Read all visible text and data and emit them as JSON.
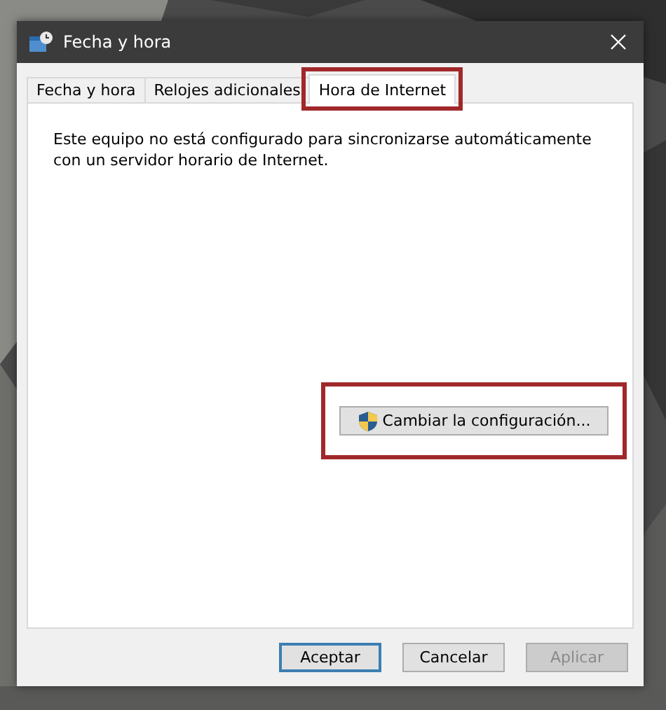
{
  "window": {
    "title": "Fecha y hora"
  },
  "tabs": [
    {
      "label": "Fecha y hora",
      "selected": false,
      "highlighted": false
    },
    {
      "label": "Relojes adicionales",
      "selected": false,
      "highlighted": false
    },
    {
      "label": "Hora de Internet",
      "selected": true,
      "highlighted": true
    }
  ],
  "message": "Este equipo no está configurado para sincronizarse automáticamente con un servidor horario de Internet.",
  "change_button": {
    "label": "Cambiar la configuración...",
    "highlighted": true
  },
  "buttons": [
    {
      "label": "Aceptar",
      "default": true,
      "disabled": false
    },
    {
      "label": "Cancelar",
      "default": false,
      "disabled": false
    },
    {
      "label": "Aplicar",
      "default": false,
      "disabled": true
    }
  ]
}
